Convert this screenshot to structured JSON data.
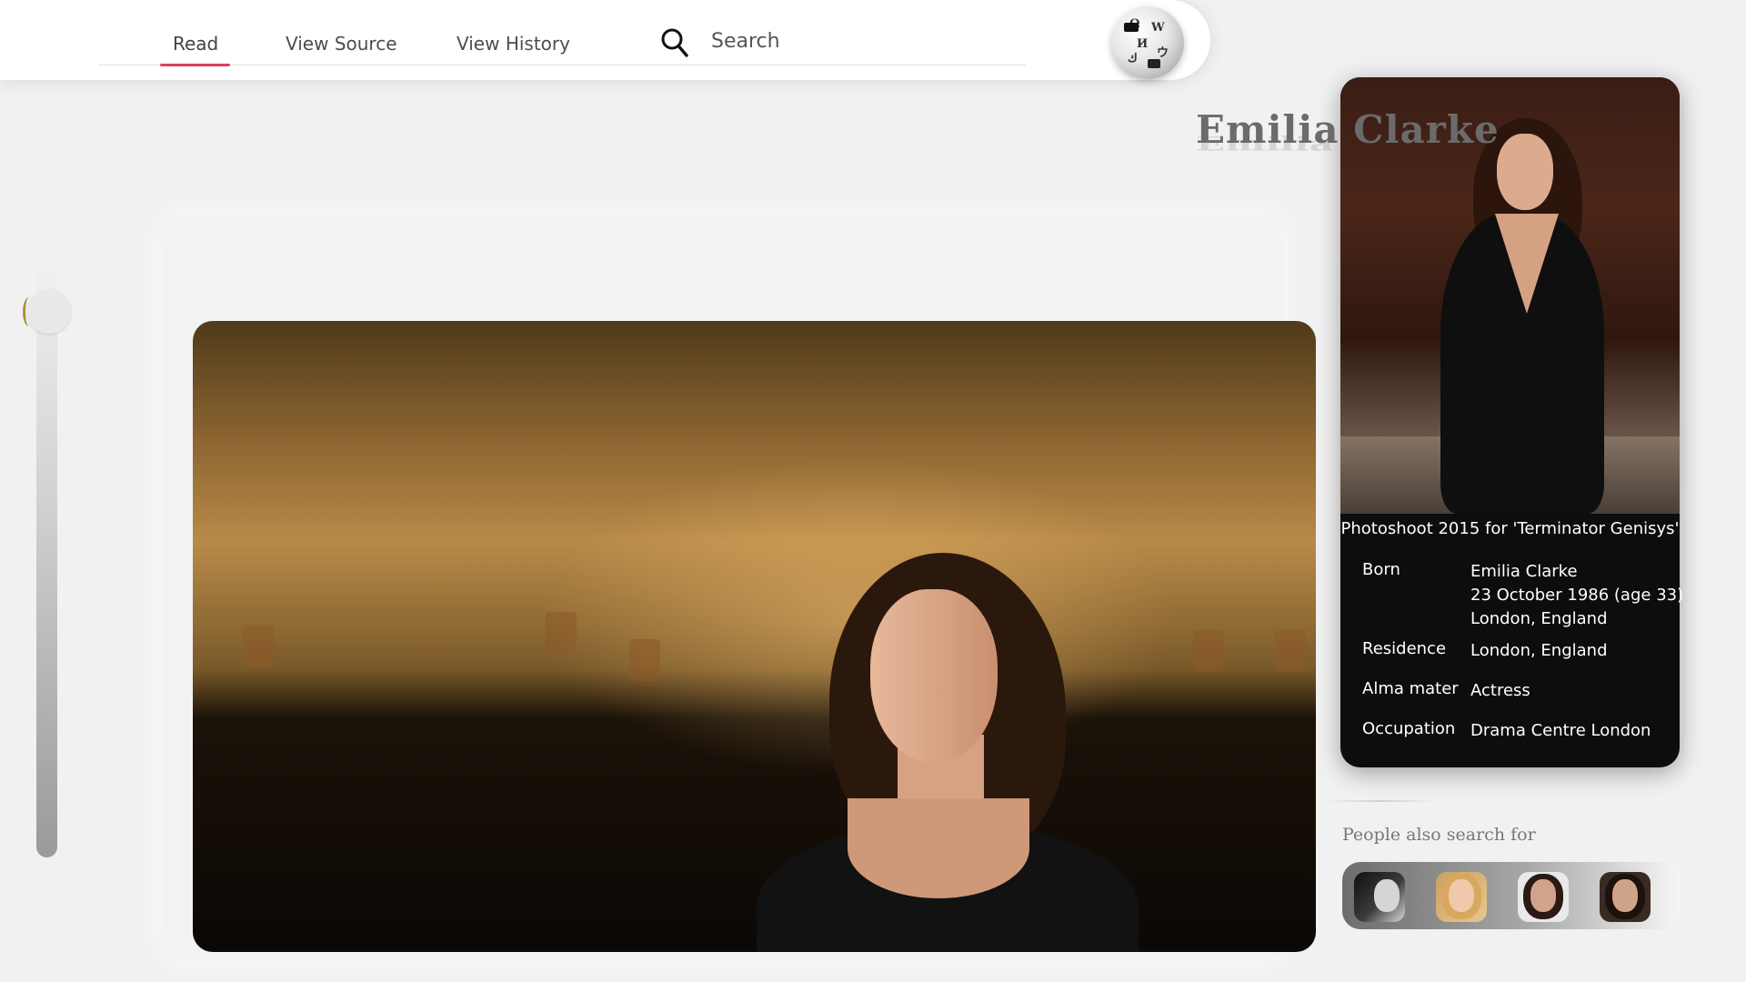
{
  "nav": {
    "tabs": [
      {
        "label": "Read",
        "active": true
      },
      {
        "label": "View Source",
        "active": false
      },
      {
        "label": "View History",
        "active": false
      }
    ],
    "search_label": "Search",
    "accent_color": "#d9435a",
    "logo_icon": "wikipedia-globe-icon"
  },
  "article": {
    "title": "Emilia Clarke"
  },
  "slider": {
    "position": 0.05
  },
  "infobox": {
    "caption": "Photoshoot 2015 for 'Terminator Genisys'",
    "rows": [
      {
        "label": "Born",
        "value_lines": [
          "Emilia  Clarke",
          "23 October 1986 (age 33)",
          "London, England"
        ]
      },
      {
        "label": "Residence",
        "value_lines": [
          "London, England"
        ]
      },
      {
        "label": "Alma mater",
        "value_lines": [
          "Actress"
        ]
      },
      {
        "label": "Occupation",
        "value_lines": [
          "Drama Centre London"
        ]
      }
    ]
  },
  "people_also_search": {
    "title": "People also search for",
    "count": 4
  }
}
